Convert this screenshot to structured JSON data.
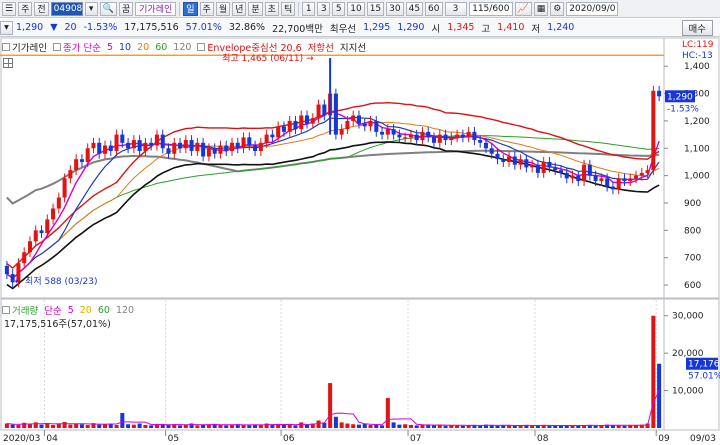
{
  "toolbar": {
    "menu_icon": "menu-icon",
    "label_type": "주",
    "label_prev": "전",
    "code": "049080",
    "search_icon": "search-icon",
    "label_sub": "꿈",
    "stock_name": "기가레인",
    "periods": [
      "일",
      "주",
      "월",
      "년",
      "분",
      "초",
      "틱"
    ],
    "minutes": [
      "1",
      "3",
      "5",
      "10",
      "15",
      "30",
      "45",
      "60"
    ],
    "minute_sel": "3",
    "count": "115/600",
    "date": "2020/09/0"
  },
  "quote": {
    "price": "1,290",
    "arrow": "▼",
    "change": "20",
    "rate": "-1.53%",
    "volume": "17,175,516",
    "turnover": "57.01%",
    "ratio": "32.86%",
    "amount": "22,700백만",
    "priority_label": "최우선",
    "ask": "1,295",
    "bid": "1,290",
    "open_label": "시",
    "open": "1,345",
    "high_label": "고",
    "high": "1,410",
    "low_label": "저",
    "low": "1,240",
    "buy": "매수"
  },
  "legend": {
    "name": "기가레인",
    "ma_title": "종가 단순",
    "ma_periods": [
      "5",
      "10",
      "20",
      "60",
      "120"
    ],
    "envelope": "Envelope중심선 20,6",
    "resist": "저항선",
    "support": "지지선",
    "lc": "LC:119",
    "hc": "HC:-13"
  },
  "volume_legend": {
    "title": "거래량",
    "ma_title": "단순",
    "ma_periods": [
      "5",
      "20",
      "60",
      "120"
    ],
    "readout": "17,175,516주(57,01%)"
  },
  "colors": {
    "up": "#e11414",
    "down": "#1736d6",
    "ma5": "#d400d4",
    "ma10": "#1d3fb0",
    "ma20": "#e07a1f",
    "ma60": "#2aa02a",
    "ma120": "#808080",
    "env": "#dd1111",
    "resist": "#ff8a00"
  },
  "chart_data": {
    "type": "candlestick",
    "price_axis": [
      1400,
      1300,
      1200,
      1100,
      1000,
      900,
      800,
      700,
      600
    ],
    "price_range": [
      560,
      1430
    ],
    "current_price": "1,290",
    "current_rate": "-1.53%",
    "high_annotation": "최고 1,465 (06/11)",
    "low_annotation": "최저 588 (03/23)",
    "resistance": 1440,
    "volume_axis": [
      "30,000",
      "20,000",
      "10,000"
    ],
    "volume_range": [
      0,
      31000
    ],
    "current_volume": "17,176",
    "volume_rate": "57.01%",
    "x_labels": [
      "2020/03",
      "04",
      "05",
      "06",
      "07",
      "08",
      "09",
      "09/03"
    ],
    "months": [
      {
        "label": "04",
        "index": 7
      },
      {
        "label": "05",
        "index": 28
      },
      {
        "label": "06",
        "index": 48
      },
      {
        "label": "07",
        "index": 70
      },
      {
        "label": "08",
        "index": 92
      },
      {
        "label": "09",
        "index": 113
      }
    ],
    "closes": [
      640,
      610,
      680,
      720,
      760,
      800,
      790,
      840,
      880,
      920,
      990,
      1020,
      1060,
      1050,
      1100,
      1120,
      1080,
      1110,
      1090,
      1150,
      1120,
      1100,
      1130,
      1090,
      1120,
      1110,
      1150,
      1100,
      1080,
      1120,
      1100,
      1130,
      1090,
      1120,
      1070,
      1100,
      1080,
      1110,
      1090,
      1120,
      1100,
      1140,
      1110,
      1090,
      1120,
      1150,
      1140,
      1180,
      1160,
      1200,
      1170,
      1220,
      1190,
      1210,
      1260,
      1220,
      1300,
      1150,
      1170,
      1200,
      1220,
      1190,
      1180,
      1200,
      1160,
      1150,
      1170,
      1150,
      1140,
      1140,
      1150,
      1130,
      1160,
      1140,
      1120,
      1150,
      1130,
      1140,
      1150,
      1140,
      1160,
      1130,
      1120,
      1100,
      1080,
      1060,
      1050,
      1070,
      1040,
      1060,
      1030,
      1040,
      1010,
      1050,
      1030,
      1020,
      1010,
      990,
      1000,
      980,
      1040,
      1000,
      980,
      990,
      960,
      950,
      990,
      980,
      990,
      1000,
      1010,
      1020,
      1310,
      1290
    ],
    "volumes": [
      1200,
      900,
      800,
      1400,
      1000,
      1500,
      900,
      1300,
      800,
      1100,
      1600,
      900,
      1200,
      1000,
      800,
      1300,
      900,
      1100,
      1200,
      800,
      4000,
      1000,
      900,
      1200,
      800,
      700,
      1100,
      900,
      800,
      1000,
      700,
      900,
      1200,
      700,
      800,
      900,
      1100,
      800,
      700,
      900,
      1000,
      800,
      700,
      900,
      800,
      1200,
      900,
      1000,
      800,
      900,
      700,
      1500,
      800,
      1200,
      2000,
      1400,
      12000,
      3000,
      1500,
      1200,
      1000,
      900,
      1100,
      800,
      900,
      700,
      8000,
      1500,
      900,
      1000,
      800,
      700,
      900,
      800,
      700,
      900,
      600,
      800,
      700,
      600,
      800,
      700,
      600,
      900,
      700,
      600,
      800,
      700,
      600,
      700,
      800,
      600,
      700,
      800,
      600,
      700,
      600,
      700,
      800,
      600,
      700,
      800,
      600,
      700,
      900,
      700,
      800,
      600,
      700,
      800,
      900,
      1200,
      30000,
      17176
    ]
  }
}
